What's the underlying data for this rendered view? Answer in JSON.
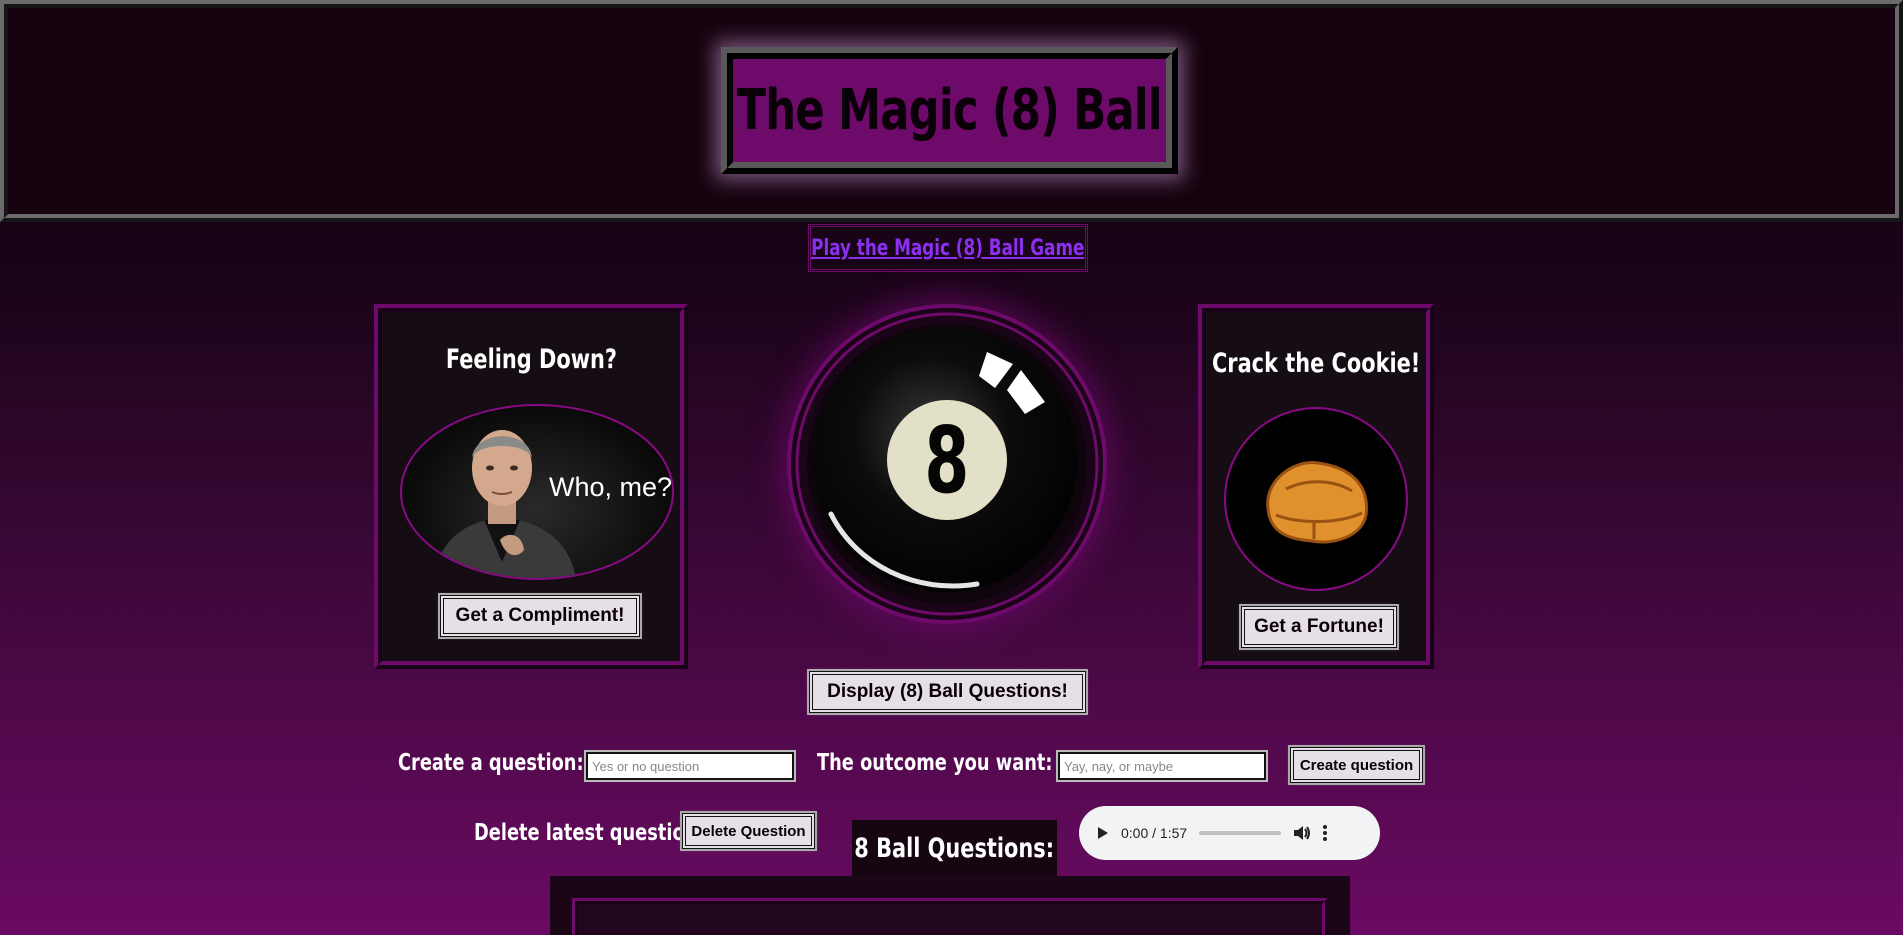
{
  "header": {
    "title": "The Magic (8) Ball"
  },
  "nav": {
    "play_link": "Play the Magic (8) Ball Game"
  },
  "compliment_card": {
    "heading": "Feeling Down?",
    "image_caption": "Who, me?",
    "button": "Get a Compliment!"
  },
  "fortune_card": {
    "heading": "Crack the Cookie!",
    "button": "Get a Fortune!"
  },
  "eight_ball": {
    "number": "8"
  },
  "actions": {
    "display_questions": "Display (8) Ball Questions!"
  },
  "create_form": {
    "question_label": "Create a question:",
    "question_placeholder": "Yes or no question",
    "outcome_label": "The outcome you want:",
    "outcome_placeholder": "Yay, nay, or maybe",
    "create_button": "Create question"
  },
  "delete_form": {
    "label": "Delete latest question:",
    "button": "Delete Question"
  },
  "questions": {
    "title": "8 Ball Questions:"
  },
  "audio": {
    "time": "0:00 / 1:57",
    "progress": 0
  },
  "colors": {
    "accent": "#6e0a6a",
    "link": "#8c2ff0",
    "button_bg": "#e6e0e6"
  },
  "icons": [
    "play-icon",
    "volume-icon",
    "more-options-icon"
  ]
}
